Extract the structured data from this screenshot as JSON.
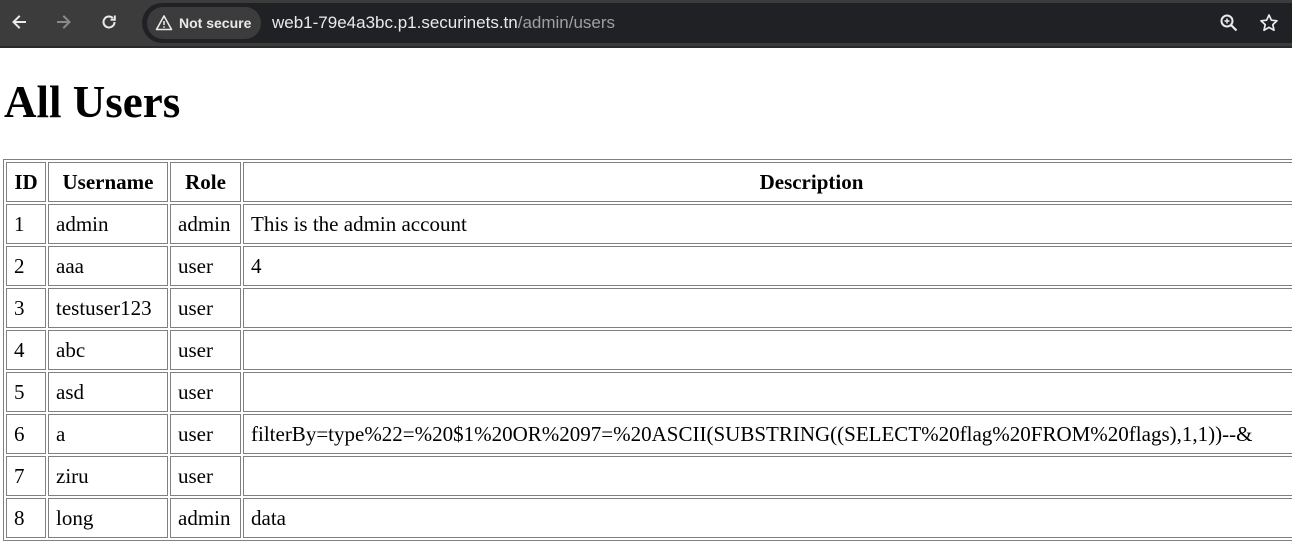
{
  "browser": {
    "security_label": "Not secure",
    "url_host": "web1-79e4a3bc.p1.securinets.tn",
    "url_path": "/admin/users",
    "icons": [
      "back-icon",
      "forward-icon",
      "reload-icon",
      "warning-icon",
      "zoom-icon",
      "star-icon"
    ]
  },
  "page": {
    "title": "All Users"
  },
  "table": {
    "headers": {
      "id": "ID",
      "username": "Username",
      "role": "Role",
      "description": "Description"
    },
    "rows": [
      {
        "id": "1",
        "username": "admin",
        "role": "admin",
        "description": "This is the admin account"
      },
      {
        "id": "2",
        "username": "aaa",
        "role": "user",
        "description": "4"
      },
      {
        "id": "3",
        "username": "testuser123",
        "role": "user",
        "description": ""
      },
      {
        "id": "4",
        "username": "abc",
        "role": "user",
        "description": ""
      },
      {
        "id": "5",
        "username": "asd",
        "role": "user",
        "description": ""
      },
      {
        "id": "6",
        "username": "a",
        "role": "user",
        "description": "filterBy=type%22=%20$1%20OR%2097=%20ASCII(SUBSTRING((SELECT%20flag%20FROM%20flags),1,1))--&"
      },
      {
        "id": "7",
        "username": "ziru",
        "role": "user",
        "description": ""
      },
      {
        "id": "8",
        "username": "long",
        "role": "admin",
        "description": "data"
      }
    ]
  }
}
